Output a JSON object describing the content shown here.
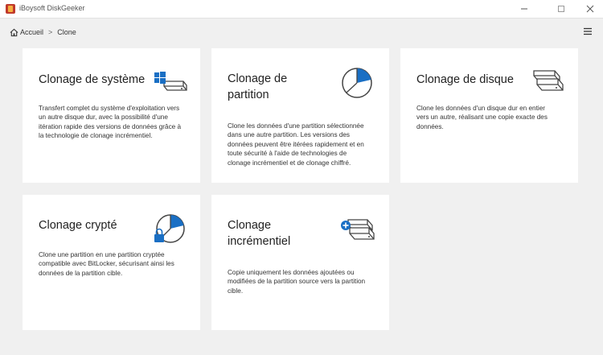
{
  "window": {
    "title": "iBoysoft DiskGeeker"
  },
  "breadcrumb": {
    "home": "Accueil",
    "separator": ">",
    "current": "Clone"
  },
  "cards": [
    {
      "title": "Clonage de système",
      "description": "Transfert complet du système d'exploitation vers un autre disque dur, avec la possibilité d'une itération rapide des versions de données grâce à la technologie de clonage incrémentiel."
    },
    {
      "title": "Clonage de partition",
      "description": "Clone les données d'une partition sélectionnée dans une autre partition. Les versions des données peuvent être itérées rapidement et en toute sécurité à l'aide de technologies de clonage incrémentiel et de clonage chiffré."
    },
    {
      "title": "Clonage de disque",
      "description": "Clone les données d'un disque dur en entier vers un autre, réalisant une copie exacte des données."
    },
    {
      "title": "Clonage crypté",
      "description": "Clone une partition en une partition cryptée compatible avec BitLocker, sécurisant ainsi les données de la partition cible."
    },
    {
      "title": "Clonage incrémentiel",
      "description": "Copie uniquement les données ajoutées ou modifiées de la partition source vers la partition cible."
    }
  ],
  "colors": {
    "accent": "#1a6fc4",
    "icon_stroke": "#444444",
    "background": "#f0f0f0",
    "card": "#ffffff"
  },
  "icons": {
    "app": "app-logo-icon",
    "home": "home-icon",
    "menu": "hamburger-menu-icon",
    "system": "windows-disk-icon",
    "partition": "pie-partition-icon",
    "disk": "disk-stack-icon",
    "encrypted": "lock-pie-icon",
    "incremental": "plus-disk-icon"
  }
}
